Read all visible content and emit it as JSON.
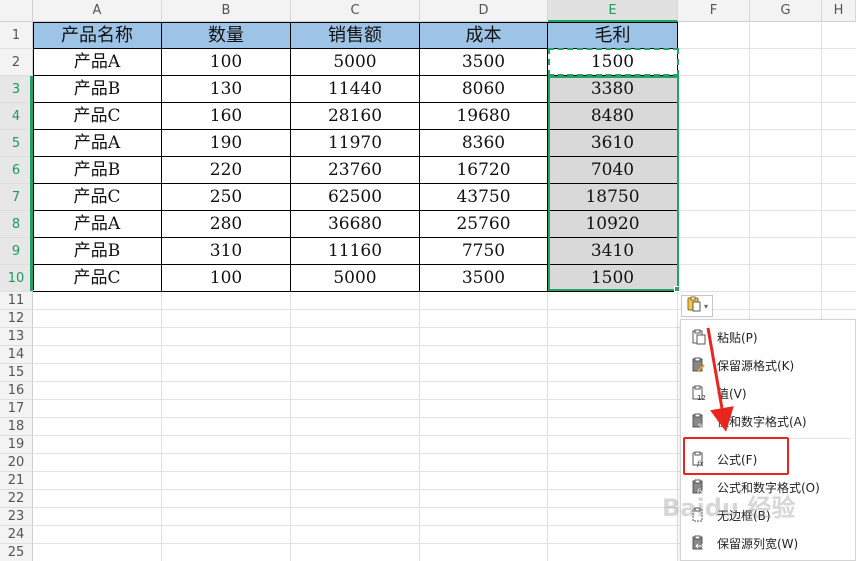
{
  "columns": [
    "A",
    "B",
    "C",
    "D",
    "E",
    "F",
    "G",
    "H"
  ],
  "active_column": "E",
  "rows": [
    "1",
    "2",
    "3",
    "4",
    "5",
    "6",
    "7",
    "8",
    "9",
    "10",
    "11",
    "12",
    "13",
    "14",
    "15",
    "16",
    "17",
    "18",
    "19",
    "20",
    "21",
    "22",
    "23",
    "24",
    "25"
  ],
  "table": {
    "headers": [
      "产品名称",
      "数量",
      "销售额",
      "成本",
      "毛利"
    ],
    "data": [
      [
        "产品A",
        "100",
        "5000",
        "3500",
        "1500"
      ],
      [
        "产品B",
        "130",
        "11440",
        "8060",
        "3380"
      ],
      [
        "产品C",
        "160",
        "28160",
        "19680",
        "8480"
      ],
      [
        "产品A",
        "190",
        "11970",
        "8360",
        "3610"
      ],
      [
        "产品B",
        "220",
        "23760",
        "16720",
        "7040"
      ],
      [
        "产品C",
        "250",
        "62500",
        "43750",
        "18750"
      ],
      [
        "产品A",
        "280",
        "36680",
        "25760",
        "10920"
      ],
      [
        "产品B",
        "310",
        "11160",
        "7750",
        "3410"
      ],
      [
        "产品C",
        "100",
        "5000",
        "3500",
        "1500"
      ]
    ]
  },
  "paste_menu": {
    "items": [
      {
        "label": "粘贴(P)",
        "icon": "paste-icon"
      },
      {
        "label": "保留源格式(K)",
        "icon": "paste-keep-format-icon"
      },
      {
        "label": "值(V)",
        "icon": "paste-values-icon"
      },
      {
        "label": "值和数字格式(A)",
        "icon": "paste-values-number-format-icon"
      },
      {
        "label": "公式(F)",
        "icon": "paste-formula-icon"
      },
      {
        "label": "公式和数字格式(O)",
        "icon": "paste-formula-number-format-icon"
      },
      {
        "label": "无边框(B)",
        "icon": "paste-no-border-icon"
      },
      {
        "label": "保留源列宽(W)",
        "icon": "paste-keep-column-width-icon"
      }
    ]
  },
  "watermark": "Baidu 经验",
  "colors": {
    "header_fill": "#9dc3e6",
    "selected_fill": "#d9d9d9",
    "selection_border": "#21a366",
    "highlight_red": "#e8261f"
  }
}
